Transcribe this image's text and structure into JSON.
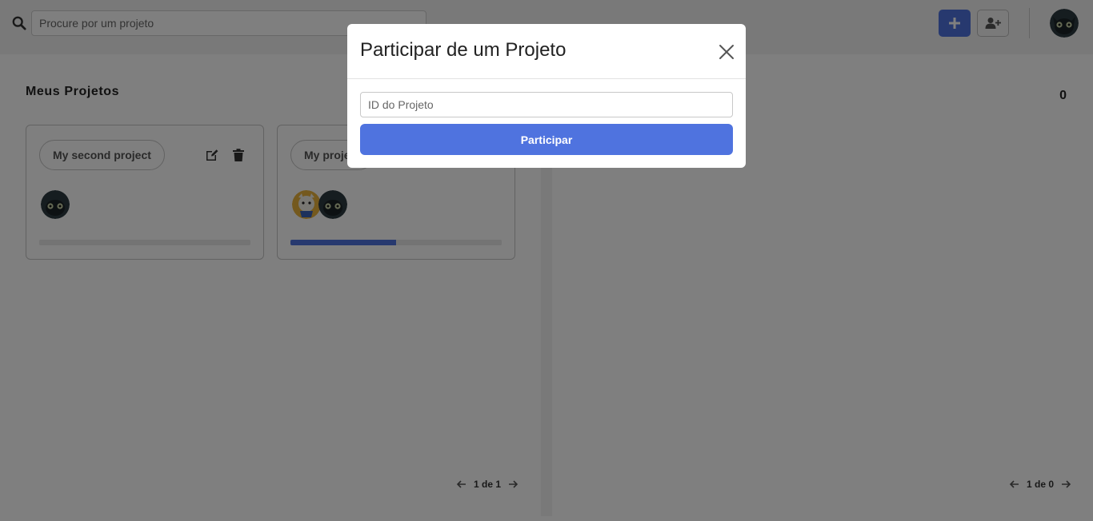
{
  "header": {
    "search_placeholder": "Procure por um projeto",
    "icons": [
      "search-icon",
      "plus-icon",
      "user-plus-icon"
    ]
  },
  "my_projects": {
    "title": "Meus Projetos",
    "cards": [
      {
        "name": "My second project",
        "progress": 0
      },
      {
        "name": "My project",
        "progress": 0.5
      }
    ],
    "pager": "1 de 1"
  },
  "other_projects": {
    "count": "0",
    "pager": "1 de 0"
  },
  "modal": {
    "title": "Participar de um Projeto",
    "input_placeholder": "ID do Projeto",
    "submit_label": "Participar"
  },
  "colors": {
    "accent": "#4f73df",
    "overlay": "rgba(0,0,0,0.5)"
  }
}
